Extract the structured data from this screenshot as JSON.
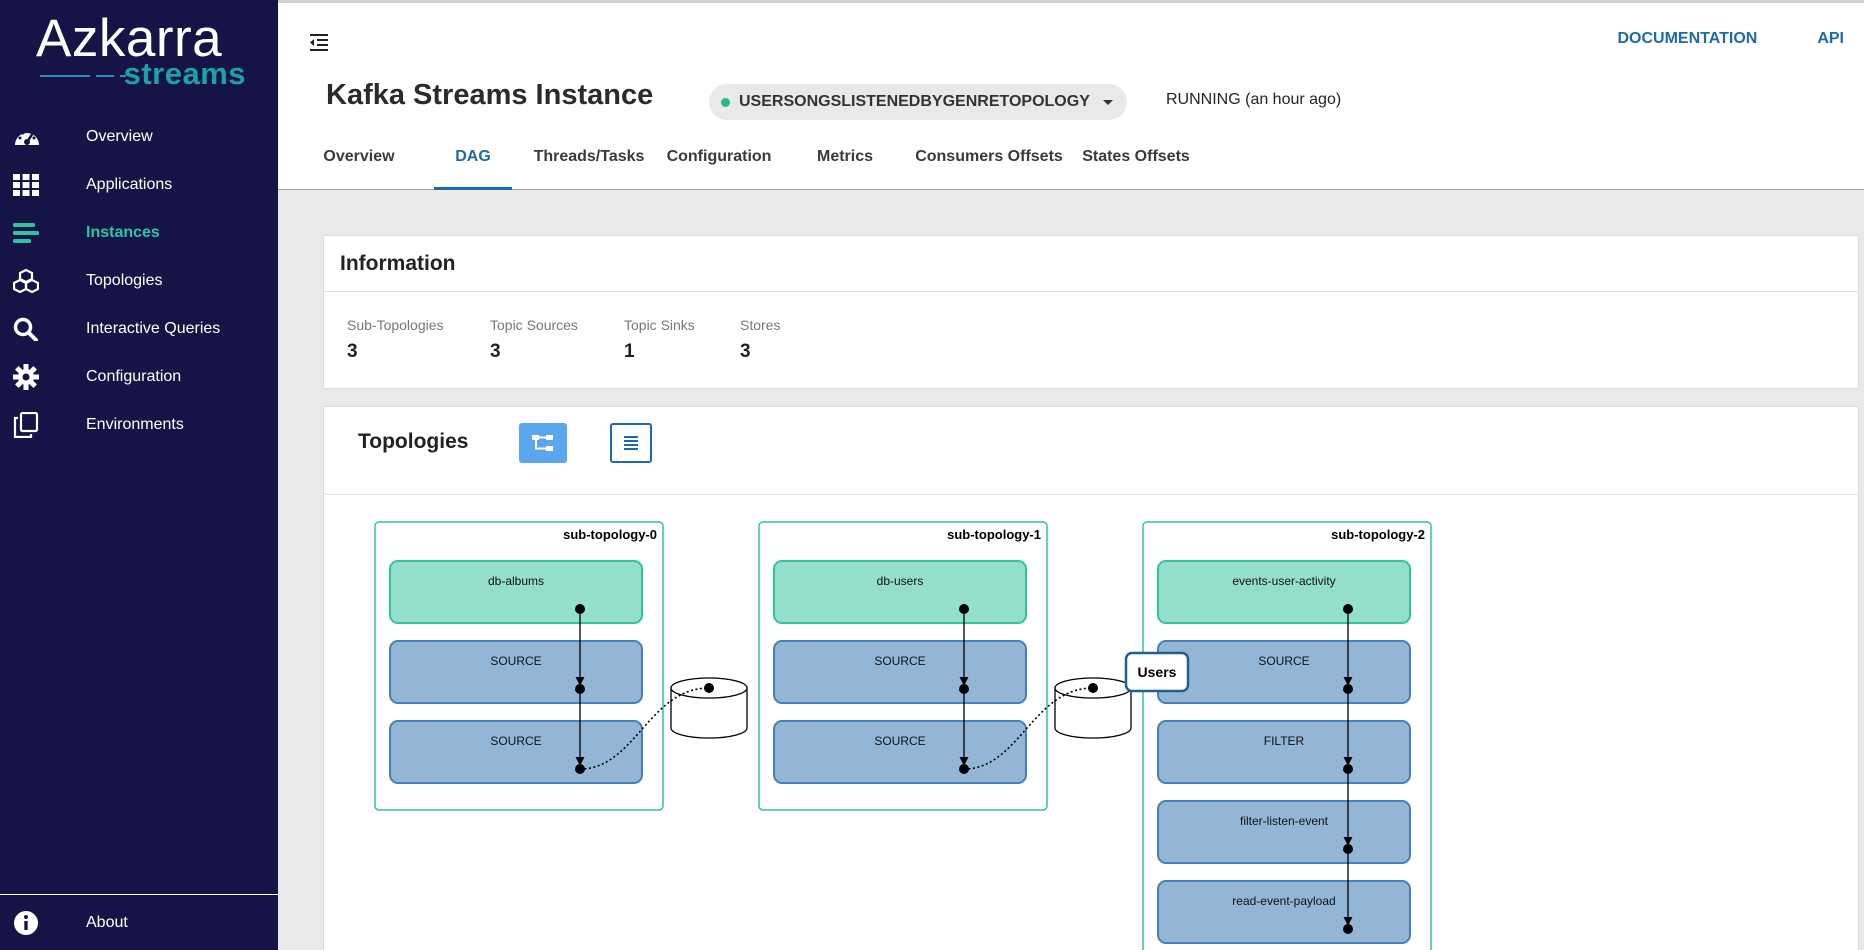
{
  "brand": {
    "name": "Azkarra",
    "sub": "streams"
  },
  "nav": {
    "items": [
      {
        "label": "Overview",
        "icon": "dashboard-gauge-icon",
        "active": false
      },
      {
        "label": "Applications",
        "icon": "grid-icon",
        "active": false
      },
      {
        "label": "Instances",
        "icon": "list-lines-icon",
        "active": true
      },
      {
        "label": "Topologies",
        "icon": "cubes-icon",
        "active": false
      },
      {
        "label": "Interactive Queries",
        "icon": "search-icon",
        "active": false
      },
      {
        "label": "Configuration",
        "icon": "gear-icon",
        "active": false
      },
      {
        "label": "Environments",
        "icon": "copy-icon",
        "active": false
      }
    ],
    "about": "About"
  },
  "header": {
    "links": {
      "documentation": "DOCUMENTATION",
      "api": "API"
    },
    "title": "Kafka Streams Instance",
    "topology": "USERSONGSLISTENEDBYGENRETOPOLOGY",
    "status": "RUNNING (an hour ago)",
    "tabs": [
      {
        "label": "Overview",
        "active": false
      },
      {
        "label": "DAG",
        "active": true
      },
      {
        "label": "Threads/Tasks",
        "active": false
      },
      {
        "label": "Configuration",
        "active": false
      },
      {
        "label": "Metrics",
        "active": false
      },
      {
        "label": "Consumers Offsets",
        "active": false
      },
      {
        "label": "States Offsets",
        "active": false
      }
    ]
  },
  "information": {
    "title": "Information",
    "stats": [
      {
        "label": "Sub-Topologies",
        "value": "3"
      },
      {
        "label": "Topic Sources",
        "value": "3"
      },
      {
        "label": "Topic Sinks",
        "value": "1"
      },
      {
        "label": "Stores",
        "value": "3"
      }
    ]
  },
  "topologies": {
    "title": "Topologies",
    "subtopologies": [
      {
        "name": "sub-topology-0",
        "topic": "db-albums",
        "nodes": [
          "SOURCE",
          "SOURCE"
        ]
      },
      {
        "name": "sub-topology-1",
        "topic": "db-users",
        "nodes": [
          "SOURCE",
          "SOURCE"
        ]
      },
      {
        "name": "sub-topology-2",
        "topic": "events-user-activity",
        "nodes": [
          "SOURCE",
          "FILTER",
          "filter-listen-event",
          "read-event-payload"
        ]
      }
    ],
    "tooltip": "Users"
  },
  "colors": {
    "sidebar_bg": "#161446",
    "accent_green": "#2ac6a3",
    "link_blue": "#1e6aa8",
    "topic_fill": "#94dfcb",
    "node_fill": "#93b6d6",
    "node_stroke": "#4a7fb3",
    "subtopology_stroke": "#33c29b"
  }
}
